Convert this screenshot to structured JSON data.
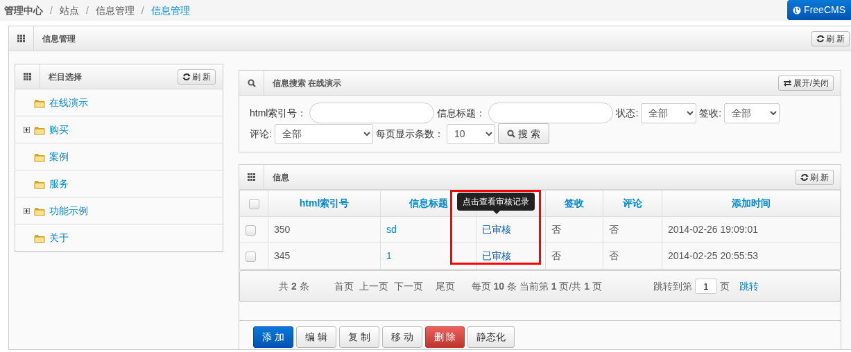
{
  "breadcrumb": [
    {
      "kind": "link",
      "label": "管理中心",
      "active": false
    },
    {
      "kind": "separator",
      "label": "/"
    },
    {
      "kind": "link",
      "label": "站点",
      "active": false
    },
    {
      "kind": "separator",
      "label": "/"
    },
    {
      "kind": "link",
      "label": "信息管理",
      "active": false
    },
    {
      "kind": "separator",
      "label": "/"
    },
    {
      "kind": "link",
      "label": "信息管理",
      "active": true
    }
  ],
  "brand_button": "FreeCMS",
  "main_panel": {
    "title": "信息管理",
    "refresh": "刷 新"
  },
  "sidebar": {
    "title": "栏目选择",
    "refresh": "刷 新",
    "items": [
      {
        "label": "在线演示",
        "expandable": false
      },
      {
        "label": "购买",
        "expandable": true
      },
      {
        "label": "案例",
        "expandable": false
      },
      {
        "label": "服务",
        "expandable": false
      },
      {
        "label": "功能示例",
        "expandable": true
      },
      {
        "label": "关于",
        "expandable": false
      }
    ]
  },
  "search": {
    "title": "信息搜索 在线演示",
    "toggle": "展开/关闭",
    "fields": [
      {
        "kind": "text",
        "label": "html索引号："
      },
      {
        "kind": "text",
        "label": "信息标题："
      },
      {
        "kind": "select",
        "label": "状态:",
        "value": "全部"
      },
      {
        "kind": "select",
        "label": "签收:",
        "value": "全部"
      },
      {
        "kind": "select",
        "label": "评论:",
        "value": "全部"
      },
      {
        "kind": "select",
        "label": "每页显示条数：",
        "value": "10"
      }
    ],
    "button": "搜 索"
  },
  "table": {
    "title": "信息",
    "refresh": "刷 新",
    "select_all_checked": false,
    "columns": [
      "html索引号",
      "信息标题",
      "",
      "签收",
      "评论",
      "添加时间"
    ],
    "tooltip": "点击查看审核记录",
    "rows": [
      {
        "checked": false,
        "cells": [
          "350",
          "sd",
          "已审核",
          "否",
          "否",
          "2014-02-26 19:09:01"
        ]
      },
      {
        "checked": false,
        "cells": [
          "345",
          "1",
          "已审核",
          "否",
          "否",
          "2014-02-25 20:55:53"
        ]
      }
    ]
  },
  "pagination": {
    "total": "共 **2** 条",
    "links": [
      "首页",
      "上一页",
      "下一页",
      "尾页"
    ],
    "info": "每页 **10** 条 当前第 **1** 页/共 **1** 页",
    "jump_label": "跳转到第",
    "jump_value": "1",
    "jump_unit": "页",
    "jump_button": "跳转"
  },
  "actions": [
    {
      "label": "添 加",
      "kind": "primary"
    },
    {
      "label": "编 辑",
      "kind": "default"
    },
    {
      "label": "复 制",
      "kind": "default"
    },
    {
      "label": "移 动",
      "kind": "default"
    },
    {
      "label": "删 除",
      "kind": "danger"
    },
    {
      "label": "静态化",
      "kind": "default"
    }
  ]
}
